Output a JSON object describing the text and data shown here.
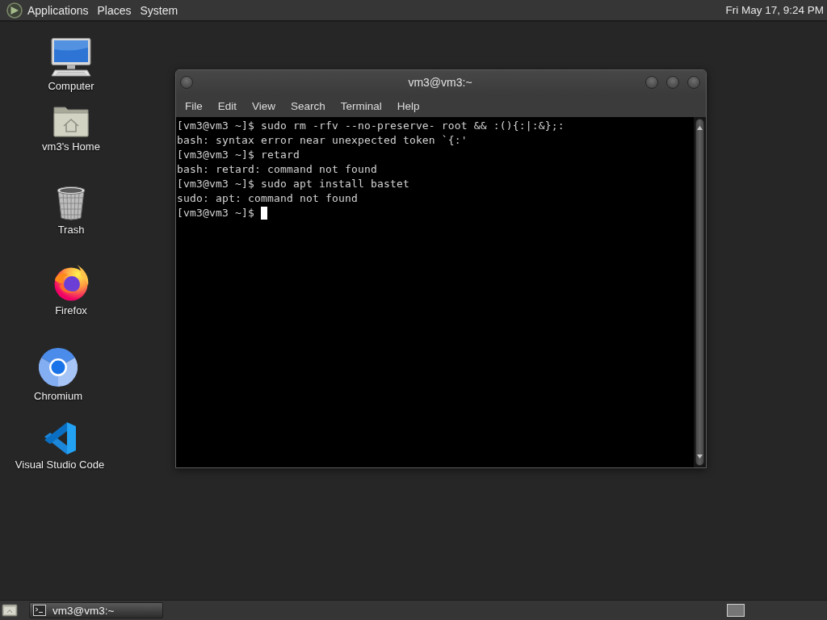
{
  "top_panel": {
    "menus": [
      "Applications",
      "Places",
      "System"
    ],
    "clock": "Fri May 17, 9:24 PM"
  },
  "desktop_icons": [
    {
      "label": "Computer",
      "kind": "computer"
    },
    {
      "label": "vm3's Home",
      "kind": "home"
    },
    {
      "label": "Trash",
      "kind": "trash"
    },
    {
      "label": "Firefox",
      "kind": "firefox"
    },
    {
      "label": "Chromium",
      "kind": "chromium"
    },
    {
      "label": "Visual Studio Code",
      "kind": "vscode"
    }
  ],
  "terminal_window": {
    "title": "vm3@vm3:~",
    "menus": [
      "File",
      "Edit",
      "View",
      "Search",
      "Terminal",
      "Help"
    ],
    "lines": [
      "[vm3@vm3 ~]$ sudo rm -rfv --no-preserve- root && :(){:|:&};:",
      "bash: syntax error near unexpected token `{:'",
      "[vm3@vm3 ~]$ retard",
      "bash: retard: command not found",
      "[vm3@vm3 ~]$ sudo apt install bastet",
      "sudo: apt: command not found",
      "[vm3@vm3 ~]$"
    ],
    "cursor": true
  },
  "bottom_panel": {
    "tasks": [
      {
        "label": "vm3@vm3:~",
        "selected": true
      }
    ]
  }
}
